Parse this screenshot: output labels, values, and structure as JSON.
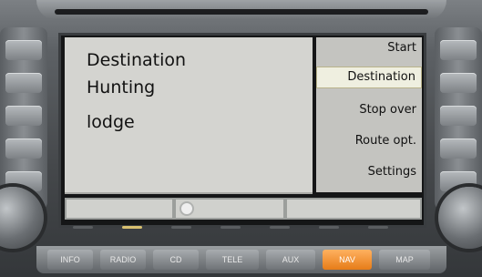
{
  "content": {
    "lines": [
      "Destination",
      "Hunting",
      "lodge"
    ]
  },
  "menu": {
    "items": [
      {
        "label": "Start",
        "selected": false
      },
      {
        "label": "Destination",
        "selected": true
      },
      {
        "label": "Stop over",
        "selected": false
      },
      {
        "label": "Route opt.",
        "selected": false
      },
      {
        "label": "Settings",
        "selected": false
      }
    ],
    "selected_color": "#efefe0"
  },
  "hardkeys": [
    {
      "label": "INFO",
      "active": false
    },
    {
      "label": "RADIO",
      "active": false
    },
    {
      "label": "CD",
      "active": false
    },
    {
      "label": "TELE",
      "active": false
    },
    {
      "label": "AUX",
      "active": false
    },
    {
      "label": "NAV",
      "active": true
    },
    {
      "label": "MAP",
      "active": false
    }
  ],
  "colors": {
    "accent": "#f08a24",
    "screen_bg": "#d4d4d0"
  },
  "icons": {
    "softkey_center": "gear-icon"
  }
}
